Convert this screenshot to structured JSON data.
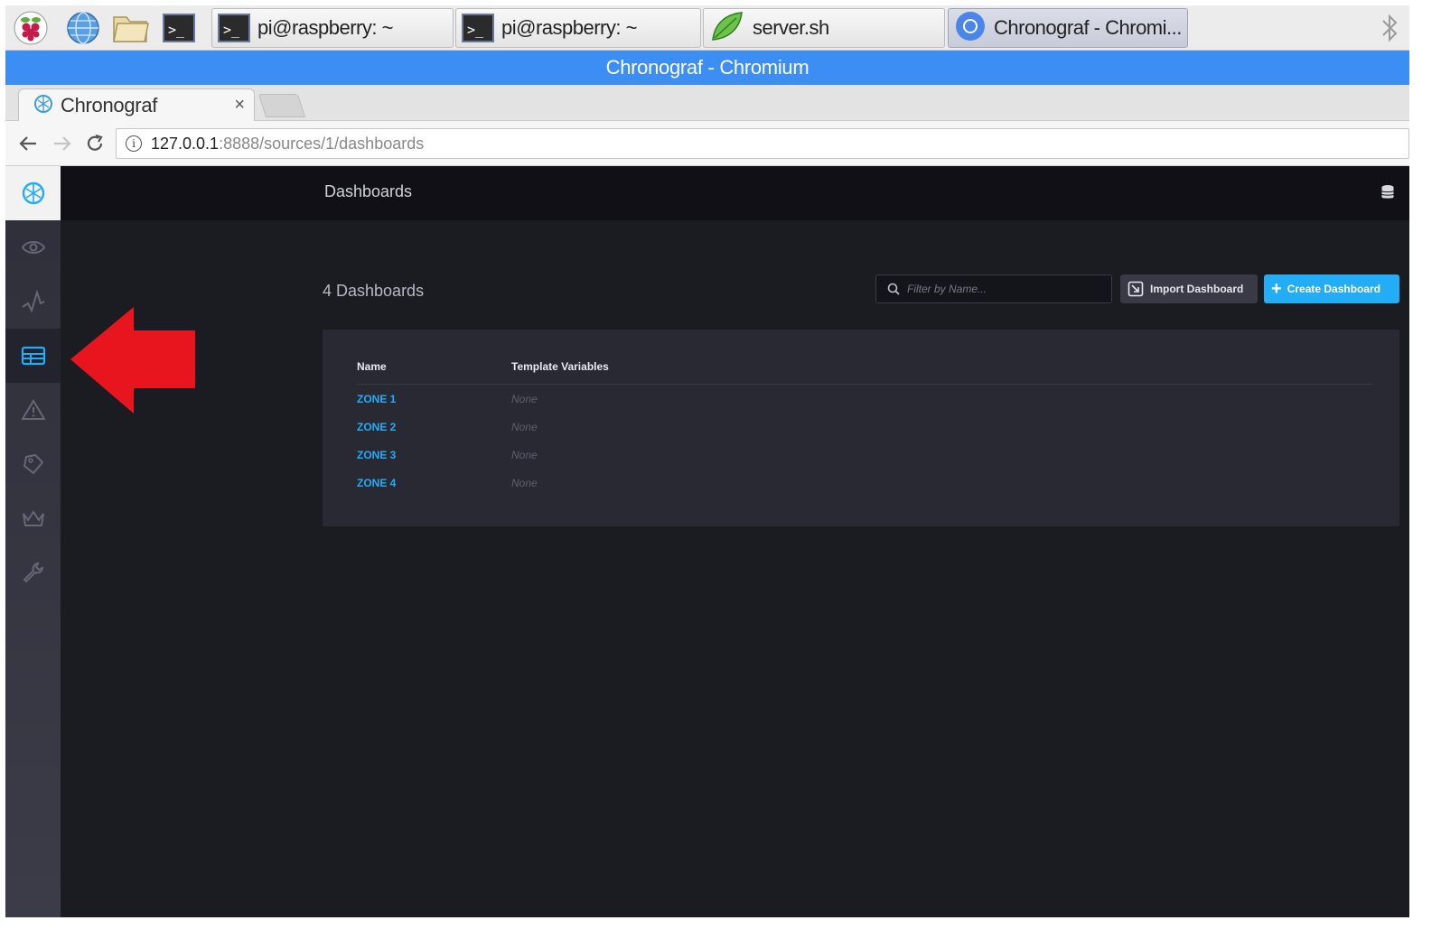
{
  "taskbar": {
    "tasks": [
      {
        "label": "pi@raspberry: ~"
      },
      {
        "label": "pi@raspberry: ~"
      },
      {
        "label": "server.sh"
      },
      {
        "label": "Chronograf - Chromi..."
      }
    ]
  },
  "window": {
    "title": "Chronograf - Chromium"
  },
  "browser": {
    "tab_title": "Chronograf",
    "tab_close": "×",
    "url_host": "127.0.0.1",
    "url_path": ":8888/sources/1/dashboards"
  },
  "app": {
    "page_title": "Dashboards",
    "dashboard_count": "4 Dashboards",
    "filter_placeholder": "Filter by Name...",
    "import_label": "Import Dashboard",
    "create_label": "Create Dashboard",
    "create_plus": "+",
    "table": {
      "headers": [
        "Name",
        "Template Variables"
      ],
      "rows": [
        {
          "name": "ZONE 1",
          "template_vars": "None"
        },
        {
          "name": "ZONE 2",
          "template_vars": "None"
        },
        {
          "name": "ZONE 3",
          "template_vars": "None"
        },
        {
          "name": "ZONE 4",
          "template_vars": "None"
        }
      ]
    }
  },
  "colors": {
    "accent": "#22adf6",
    "window_title_bar": "#3d8ef3",
    "annotation_arrow": "#e8141e"
  }
}
